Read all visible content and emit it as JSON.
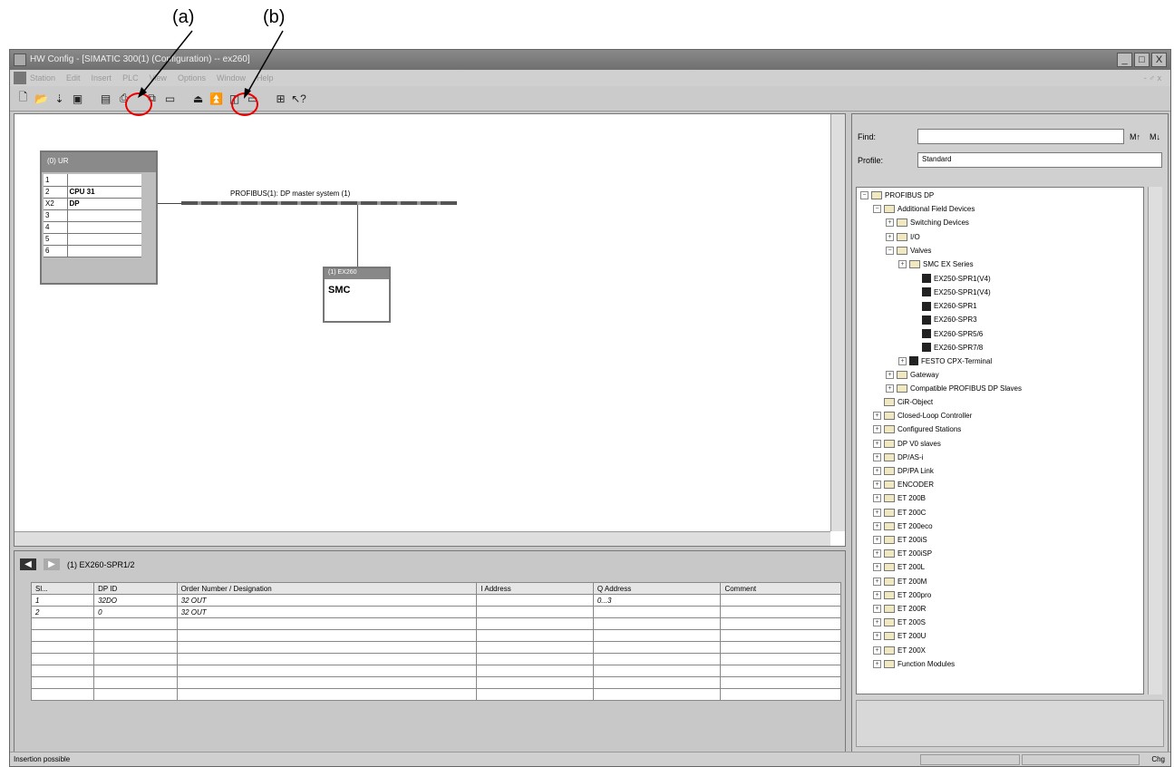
{
  "annotations": {
    "a": "(a)",
    "b": "(b)"
  },
  "window": {
    "title": "HW Config - [SIMATIC 300(1) (Configuration) -- ex260]",
    "min": "_",
    "max": "□",
    "close": "X"
  },
  "menu": {
    "items": [
      "Station",
      "Edit",
      "Insert",
      "PLC",
      "View",
      "Options",
      "Window",
      "Help"
    ],
    "right": "- ♂ x"
  },
  "toolbar": {
    "buttons": [
      "new-icon",
      "open-icon",
      "save-compile-icon",
      "save-icon",
      "print-setup-icon",
      "print-icon",
      "copy-icon",
      "paste-icon",
      "download-icon",
      "upload-icon",
      "catalog-icon",
      "module-icon",
      "network-icon",
      "help-icon"
    ]
  },
  "station": {
    "rack_title": "(0) UR",
    "rack_rows": [
      {
        "slot": "1",
        "module": ""
      },
      {
        "slot": "2",
        "module": "CPU 31"
      },
      {
        "slot": "X2",
        "module": "DP"
      },
      {
        "slot": "3",
        "module": ""
      },
      {
        "slot": "4",
        "module": ""
      },
      {
        "slot": "5",
        "module": ""
      },
      {
        "slot": "6",
        "module": ""
      }
    ],
    "dp_label": "PROFIBUS(1): DP master system (1)",
    "device_title": "(1) EX260",
    "device_label": "SMC"
  },
  "props": {
    "title": "(1)  EX260-SPR1/2",
    "columns": [
      "Sl...",
      "DP ID",
      "Order Number / Designation",
      "I Address",
      "Q Address",
      "Comment"
    ],
    "rows": [
      [
        "1",
        "32DO",
        "32 OUT",
        "",
        "0...3",
        ""
      ],
      [
        "2",
        "0",
        "32 OUT",
        "",
        "",
        ""
      ]
    ]
  },
  "catalog": {
    "find_label": "Find:",
    "profile_label": "Profile:",
    "profile_value": "Standard",
    "find_btn1": "M↑",
    "find_btn2": "M↓",
    "tree": [
      {
        "label": "PROFIBUS DP",
        "level": 0,
        "type": "root",
        "exp": "−"
      },
      {
        "label": "Additional Field Devices",
        "level": 1,
        "type": "folder",
        "exp": "−"
      },
      {
        "label": "Switching Devices",
        "level": 2,
        "type": "folder",
        "exp": "+"
      },
      {
        "label": "I/O",
        "level": 2,
        "type": "folder",
        "exp": "+"
      },
      {
        "label": "Valves",
        "level": 2,
        "type": "folder",
        "exp": "−"
      },
      {
        "label": "SMC EX Series",
        "level": 3,
        "type": "folder",
        "exp": "+"
      },
      {
        "label": "EX250-SPR1(V4)",
        "level": 4,
        "type": "gsd",
        "exp": ""
      },
      {
        "label": "EX250-SPR1(V4)",
        "level": 4,
        "type": "gsd",
        "exp": ""
      },
      {
        "label": "EX260-SPR1",
        "level": 4,
        "type": "gsd",
        "exp": ""
      },
      {
        "label": "EX260-SPR3",
        "level": 4,
        "type": "gsd",
        "exp": ""
      },
      {
        "label": "EX260-SPR5/6",
        "level": 4,
        "type": "gsd",
        "exp": ""
      },
      {
        "label": "EX260-SPR7/8",
        "level": 4,
        "type": "gsd",
        "exp": ""
      },
      {
        "label": "FESTO CPX-Terminal",
        "level": 3,
        "type": "gsd",
        "exp": "+"
      },
      {
        "label": "Gateway",
        "level": 2,
        "type": "folder",
        "exp": "+"
      },
      {
        "label": "Compatible PROFIBUS DP Slaves",
        "level": 2,
        "type": "folder",
        "exp": "+"
      },
      {
        "label": "CiR-Object",
        "level": 1,
        "type": "cir",
        "exp": ""
      },
      {
        "label": "Closed-Loop Controller",
        "level": 1,
        "type": "folder",
        "exp": "+"
      },
      {
        "label": "Configured Stations",
        "level": 1,
        "type": "folder",
        "exp": "+"
      },
      {
        "label": "DP V0 slaves",
        "level": 1,
        "type": "folder",
        "exp": "+"
      },
      {
        "label": "DP/AS-i",
        "level": 1,
        "type": "folder",
        "exp": "+"
      },
      {
        "label": "DP/PA Link",
        "level": 1,
        "type": "folder",
        "exp": "+"
      },
      {
        "label": "ENCODER",
        "level": 1,
        "type": "folder",
        "exp": "+"
      },
      {
        "label": "ET 200B",
        "level": 1,
        "type": "folder",
        "exp": "+"
      },
      {
        "label": "ET 200C",
        "level": 1,
        "type": "folder",
        "exp": "+"
      },
      {
        "label": "ET 200eco",
        "level": 1,
        "type": "folder",
        "exp": "+"
      },
      {
        "label": "ET 200iS",
        "level": 1,
        "type": "folder",
        "exp": "+"
      },
      {
        "label": "ET 200iSP",
        "level": 1,
        "type": "folder",
        "exp": "+"
      },
      {
        "label": "ET 200L",
        "level": 1,
        "type": "folder",
        "exp": "+"
      },
      {
        "label": "ET 200M",
        "level": 1,
        "type": "folder",
        "exp": "+"
      },
      {
        "label": "ET 200pro",
        "level": 1,
        "type": "folder",
        "exp": "+"
      },
      {
        "label": "ET 200R",
        "level": 1,
        "type": "folder",
        "exp": "+"
      },
      {
        "label": "ET 200S",
        "level": 1,
        "type": "folder",
        "exp": "+"
      },
      {
        "label": "ET 200U",
        "level": 1,
        "type": "folder",
        "exp": "+"
      },
      {
        "label": "ET 200X",
        "level": 1,
        "type": "folder",
        "exp": "+"
      },
      {
        "label": "Function Modules",
        "level": 1,
        "type": "folder",
        "exp": "+"
      }
    ]
  },
  "status": {
    "text": "Insertion possible",
    "right": "Chg"
  }
}
